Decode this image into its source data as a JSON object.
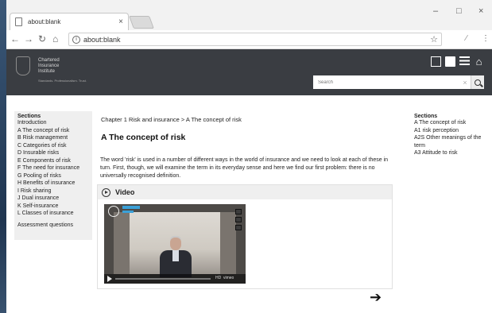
{
  "browser": {
    "tab_title": "about:blank",
    "tab_close": "×",
    "url": "about:blank",
    "window_controls": {
      "minimize": "–",
      "maximize": "□",
      "close": "×"
    },
    "icons": [
      "page-icon",
      "back-arrow-icon",
      "forward-arrow-icon",
      "reload-icon",
      "home-icon",
      "info-icon",
      "star-icon",
      "extension-icon",
      "menu-kebab-icon"
    ]
  },
  "site": {
    "logo_lines": [
      "Chartered",
      "Insurance",
      "Institute"
    ],
    "logo_tagline": "Standards. Professionalism. Trust.",
    "header_icons": [
      "contents-icon",
      "book-icon",
      "list-icon",
      "home-icon"
    ],
    "search": {
      "placeholder": "Search",
      "clear": "×"
    }
  },
  "sidebar": {
    "heading": "Sections",
    "items": [
      "Introduction",
      "A The concept of risk",
      "B Risk management",
      "C Categories of risk",
      "D Insurable risks",
      "E Components of risk",
      "F The need for insurance",
      "G Pooling of risks",
      "H Benefits of insurance",
      "I Risk sharing",
      "J Dual insurance",
      "K Self-insurance",
      "L Classes of insurance"
    ],
    "footer_item": "Assessment questions"
  },
  "main": {
    "breadcrumb": "Chapter 1 Risk and insurance > A The concept of risk",
    "title": "A The concept of risk",
    "paragraph": "The word 'risk' is used in a number of different ways in the world of insurance and we need to look at each of these in turn. First, though, we will examine the term in its everyday sense and here we find our first problem: there is no universally recognised definition.",
    "video_label": "Video",
    "video_player": {
      "hd": "HD",
      "brand": "vimeo"
    },
    "next_icon": "right-arrow-icon"
  },
  "right_sidebar": {
    "heading": "Sections",
    "items": [
      "A The concept of risk",
      "A1 risk perception",
      "A2S Other meanings of the term",
      "A3 Attitude to risk"
    ]
  },
  "colors": {
    "header_bg": "#3a3d42",
    "sidebar_bg": "#efefef",
    "video_accent": "#3aa0d8"
  }
}
